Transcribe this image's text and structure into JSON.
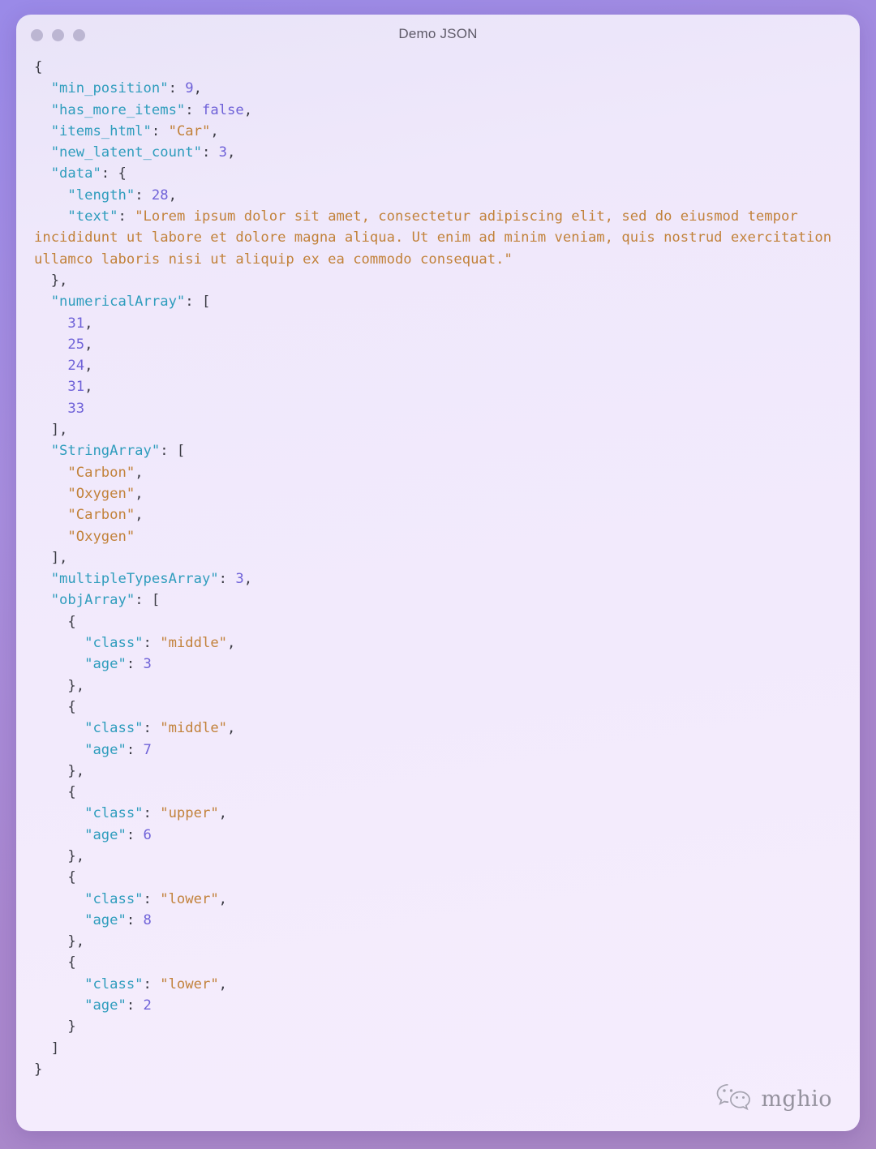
{
  "window": {
    "title": "Demo JSON",
    "traffic_lights": [
      "close-button",
      "minimize-button",
      "maximize-button"
    ],
    "colors": {
      "background_top": "#9a8ae8",
      "background_bottom": "#a988c4",
      "card": "#f1e9fb",
      "key": "#2f9dbd",
      "string": "#c2823b",
      "number": "#6f62d8",
      "boolean": "#6f62d8",
      "punctuation": "#3b3b44",
      "title_text": "#5e5a68",
      "traffic_dot": "#bcb6d2"
    }
  },
  "json_document": {
    "raw_lines": [
      "{",
      "  \"min_position\": 9,",
      "  \"has_more_items\": false,",
      "  \"items_html\": \"Car\",",
      "  \"new_latent_count\": 3,",
      "  \"data\": {",
      "    \"length\": 28,",
      "    \"text\": \"Lorem ipsum dolor sit amet, consectetur adipiscing elit, sed do eiusmod tempor incididunt ut labore et dolore magna aliqua. Ut enim ad minim veniam, quis nostrud exercitation ullamco laboris nisi ut aliquip ex ea commodo consequat.\"",
      "  },",
      "  \"numericalArray\": [",
      "    31,",
      "    25,",
      "    24,",
      "    31,",
      "    33",
      "  ],",
      "  \"StringArray\": [",
      "    \"Carbon\",",
      "    \"Oxygen\",",
      "    \"Carbon\",",
      "    \"Oxygen\"",
      "  ],",
      "  \"multipleTypesArray\": 3,",
      "  \"objArray\": [",
      "    {",
      "      \"class\": \"middle\",",
      "      \"age\": 3",
      "    },",
      "    {",
      "      \"class\": \"middle\",",
      "      \"age\": 7",
      "    },",
      "    {",
      "      \"class\": \"upper\",",
      "      \"age\": 6",
      "    },",
      "    {",
      "      \"class\": \"lower\",",
      "      \"age\": 8",
      "    },",
      "    {",
      "      \"class\": \"lower\",",
      "      \"age\": 2",
      "    }",
      "  ]",
      "}"
    ],
    "values": {
      "min_position": 9,
      "has_more_items": false,
      "items_html": "Car",
      "new_latent_count": 3,
      "data": {
        "length": 28,
        "text": "Lorem ipsum dolor sit amet, consectetur adipiscing elit, sed do eiusmod tempor incididunt ut labore et dolore magna aliqua. Ut enim ad minim veniam, quis nostrud exercitation ullamco laboris nisi ut aliquip ex ea commodo consequat."
      },
      "numericalArray": [
        31,
        25,
        24,
        31,
        33
      ],
      "StringArray": [
        "Carbon",
        "Oxygen",
        "Carbon",
        "Oxygen"
      ],
      "multipleTypesArray": 3,
      "objArray": [
        {
          "class": "middle",
          "age": 3
        },
        {
          "class": "middle",
          "age": 7
        },
        {
          "class": "upper",
          "age": 6
        },
        {
          "class": "lower",
          "age": 8
        },
        {
          "class": "lower",
          "age": 2
        }
      ]
    }
  },
  "watermark": {
    "label": "mghio",
    "icon": "wechat-icon"
  }
}
